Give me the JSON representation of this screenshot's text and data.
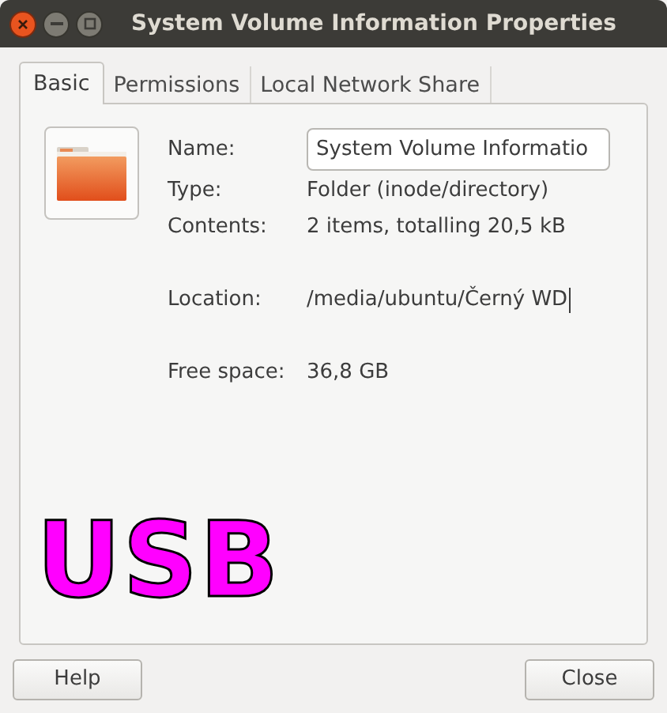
{
  "window": {
    "title": "System Volume Information Properties"
  },
  "tabs": [
    {
      "label": "Basic",
      "selected": true
    },
    {
      "label": "Permissions",
      "selected": false
    },
    {
      "label": "Local Network Share",
      "selected": false
    }
  ],
  "basic": {
    "fields": [
      {
        "kind": "input",
        "label": "Name:",
        "value": "System Volume Informatio"
      },
      {
        "kind": "text",
        "label": "Type:",
        "value": "Folder (inode/directory)"
      },
      {
        "kind": "text",
        "label": "Contents:",
        "value": "2 items, totalling 20,5 kB"
      },
      {
        "kind": "gap"
      },
      {
        "kind": "text",
        "label": "Location:",
        "value": "/media/ubuntu/Černý WD",
        "caret": true
      },
      {
        "kind": "gap"
      },
      {
        "kind": "text",
        "label": "Free space:",
        "value": "36,8 GB"
      }
    ],
    "annotation": "USB"
  },
  "buttons": [
    {
      "label": "Help"
    },
    {
      "label": "Close"
    }
  ]
}
